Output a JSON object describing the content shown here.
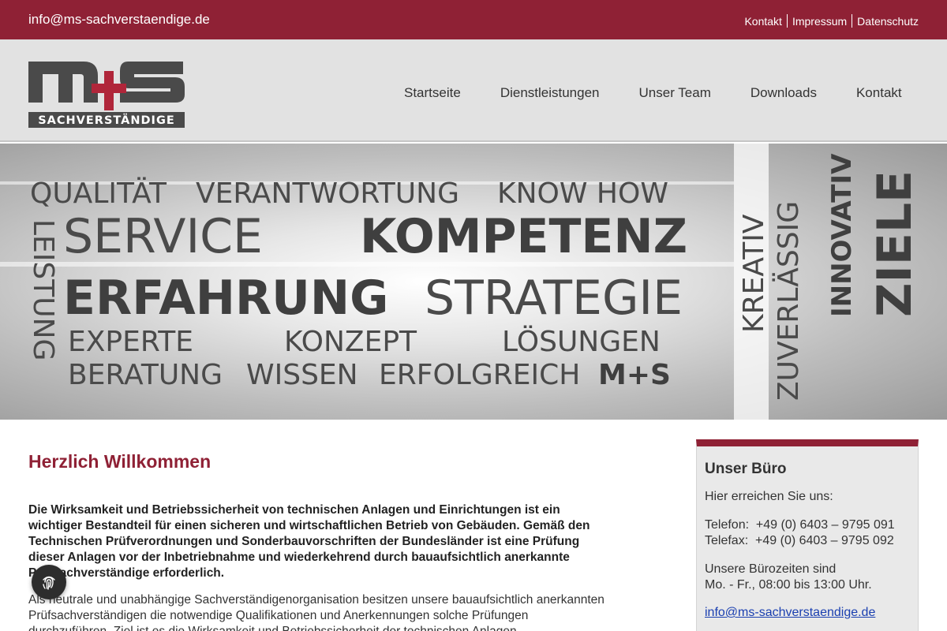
{
  "topbar": {
    "email": "info@ms-sachverstaendige.de",
    "links": [
      "Kontakt",
      "Impressum",
      "Datenschutz"
    ]
  },
  "logo": {
    "text": "m+s",
    "subtitle": "SACHVERSTÄNDIGE"
  },
  "nav": {
    "items": [
      "Startseite",
      "Dienstleistungen",
      "Unser Team",
      "Downloads",
      "Kontakt"
    ]
  },
  "banner": {
    "row1": [
      "QUALITÄT",
      "VERANTWORTUNG",
      "KNOW HOW"
    ],
    "row2": [
      "SERVICE",
      "KOMPETENZ"
    ],
    "row3": [
      "ERFAHRUNG",
      "STRATEGIE"
    ],
    "row4": [
      "EXPERTE",
      "KONZEPT",
      "LÖSUNGEN"
    ],
    "row5": [
      "BERATUNG",
      "WISSEN",
      "ERFOLGREICH",
      "M+S"
    ],
    "vertical_left": "LEISTUNG",
    "vertical_right": [
      "KREATIV",
      "ZUVERLÄSSIG",
      "INNOVATIV",
      "ZIELE"
    ]
  },
  "main": {
    "title": "Herzlich Willkommen",
    "lead": "Die Wirksamkeit und Betriebssicherheit von technischen Anlagen und Einrichtungen ist ein wichtiger Bestandteil für einen sicheren und wirtschaftlichen Betrieb von Gebäuden. Gemäß den Technischen Prüfverordnungen und Sonderbauvorschriften der Bundesländer ist eine Prüfung dieser Anlagen vor der Inbetriebnahme und wiederkehrend durch bauaufsichtlich anerkannte Prüfsachverständige erforderlich.",
    "body": "Als neutrale und unabhängige Sachverständigenorganisation besitzen unsere bauaufsichtlich anerkannten Prüfsachverständigen die notwendige Qualifikationen und Anerkennungen solche Prüfungen durchzuführen. Ziel ist es die Wirksamkeit und Betriebssicherheit der technischen Anlagen"
  },
  "sidebar": {
    "title": "Unser Büro",
    "intro": "Hier erreichen Sie uns:",
    "phone": "Telefon:  +49 (0) 6403 – 9795 091",
    "fax": "Telefax:  +49 (0) 6403 – 9795 092",
    "hours_label": "Unsere Bürozeiten sind",
    "hours": "Mo. - Fr., 08:00 bis 13:00 Uhr.",
    "email": "info@ms-sachverstaendige.de"
  },
  "colors": {
    "brand": "#8f2135",
    "header_bg": "#e2e2e2",
    "link": "#1a3fb0"
  },
  "icons": {
    "fab": "fingerprint-icon"
  }
}
